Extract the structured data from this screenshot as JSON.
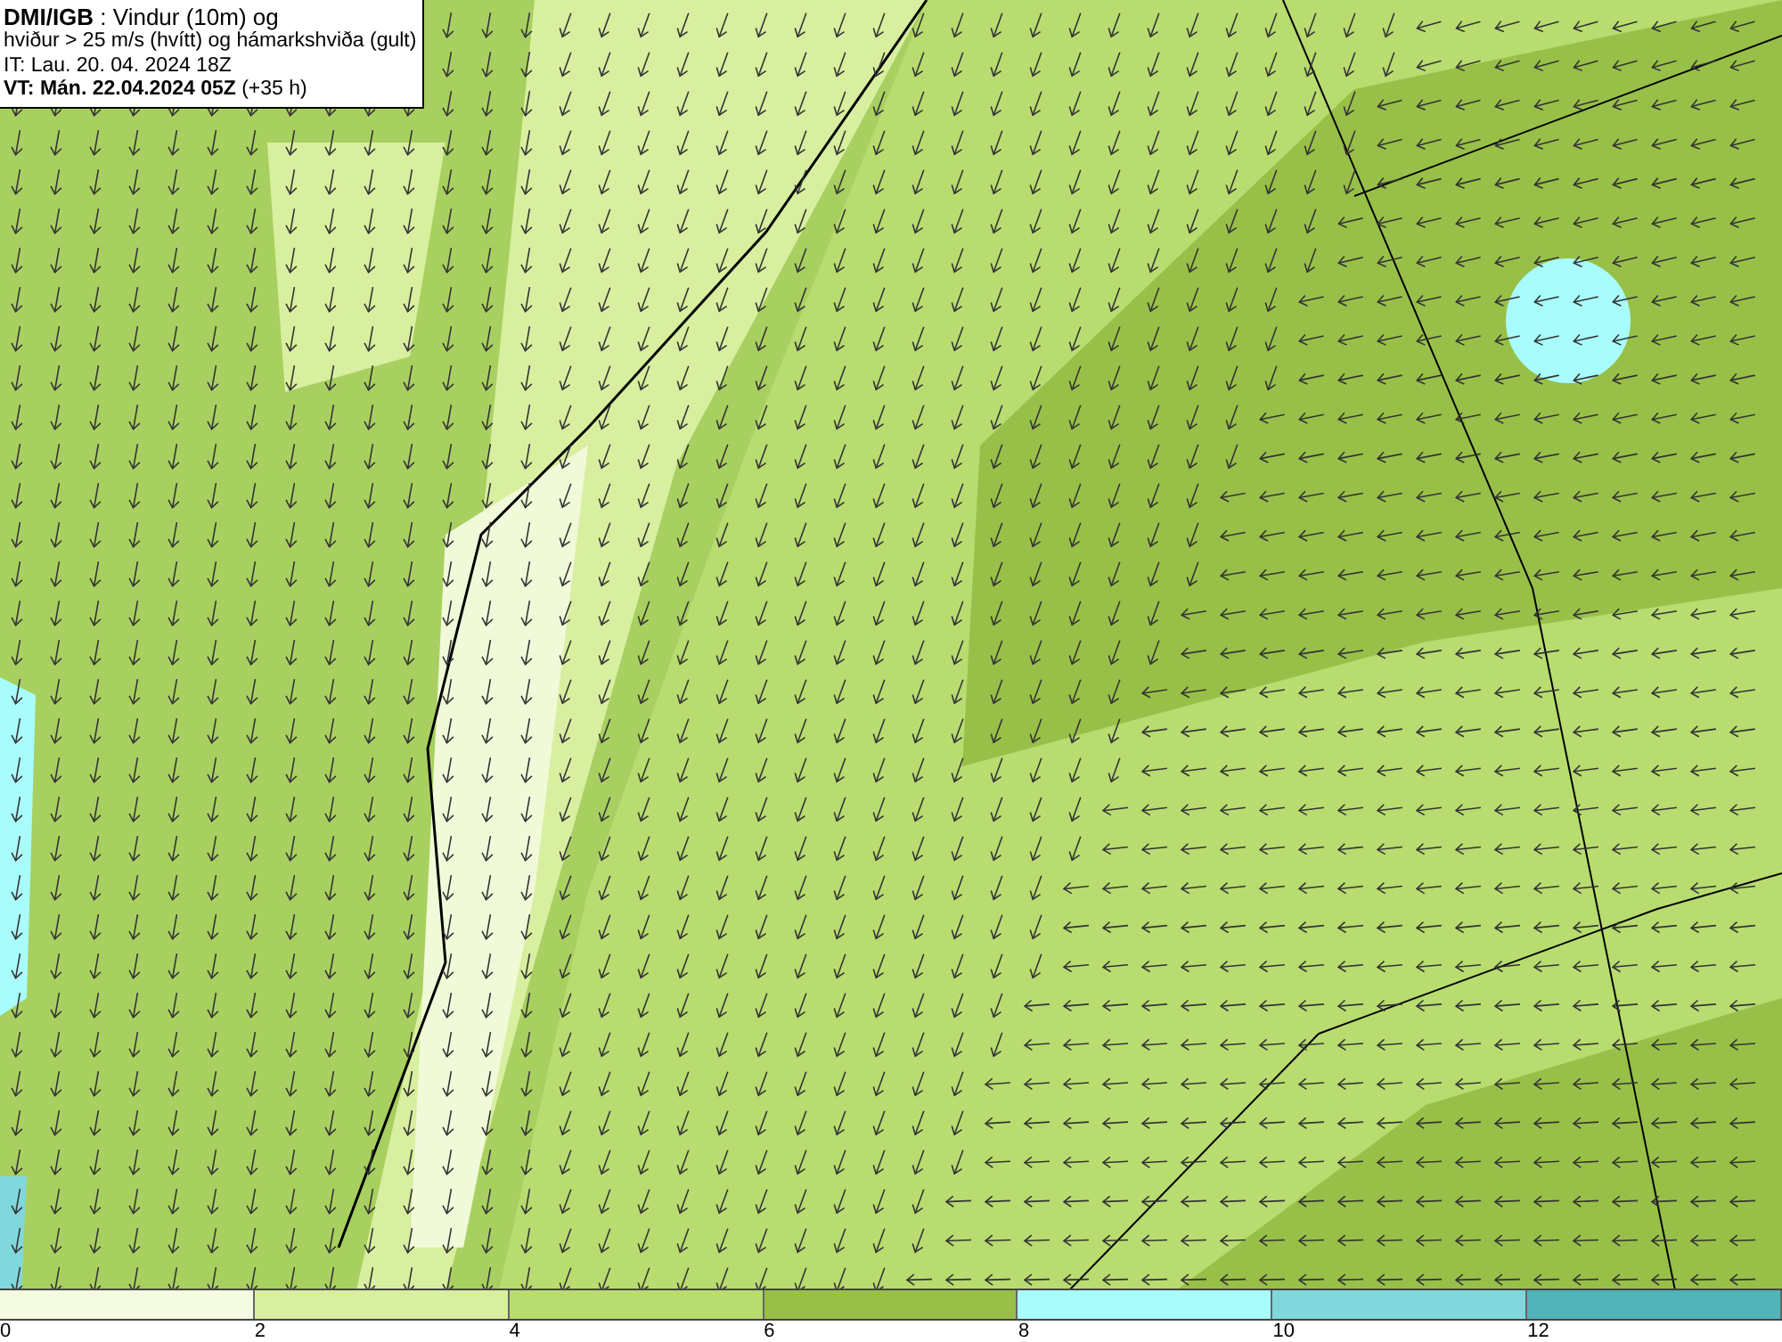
{
  "header": {
    "lines": [
      "**DMI/IGB** : Vindur (10m) og",
      "hviður > 25 m/s (hvítt) og hámarkshviða (gult)",
      "IT: Lau. 20. 04. 2024 18Z",
      "**VT: Mán. 22.04.2024 05Z** (+35 h)"
    ]
  },
  "colorbar": {
    "segments": [
      {
        "color": "#f4fbe0"
      },
      {
        "color": "#d8efa0"
      },
      {
        "color": "#b8dc70"
      },
      {
        "color": "#98c048"
      },
      {
        "color": "#a8fcfc"
      },
      {
        "color": "#80d8dc"
      },
      {
        "color": "#50b4b8"
      }
    ],
    "ticks": [
      "0",
      "2",
      "4",
      "6",
      "8",
      "10",
      "12"
    ]
  }
}
